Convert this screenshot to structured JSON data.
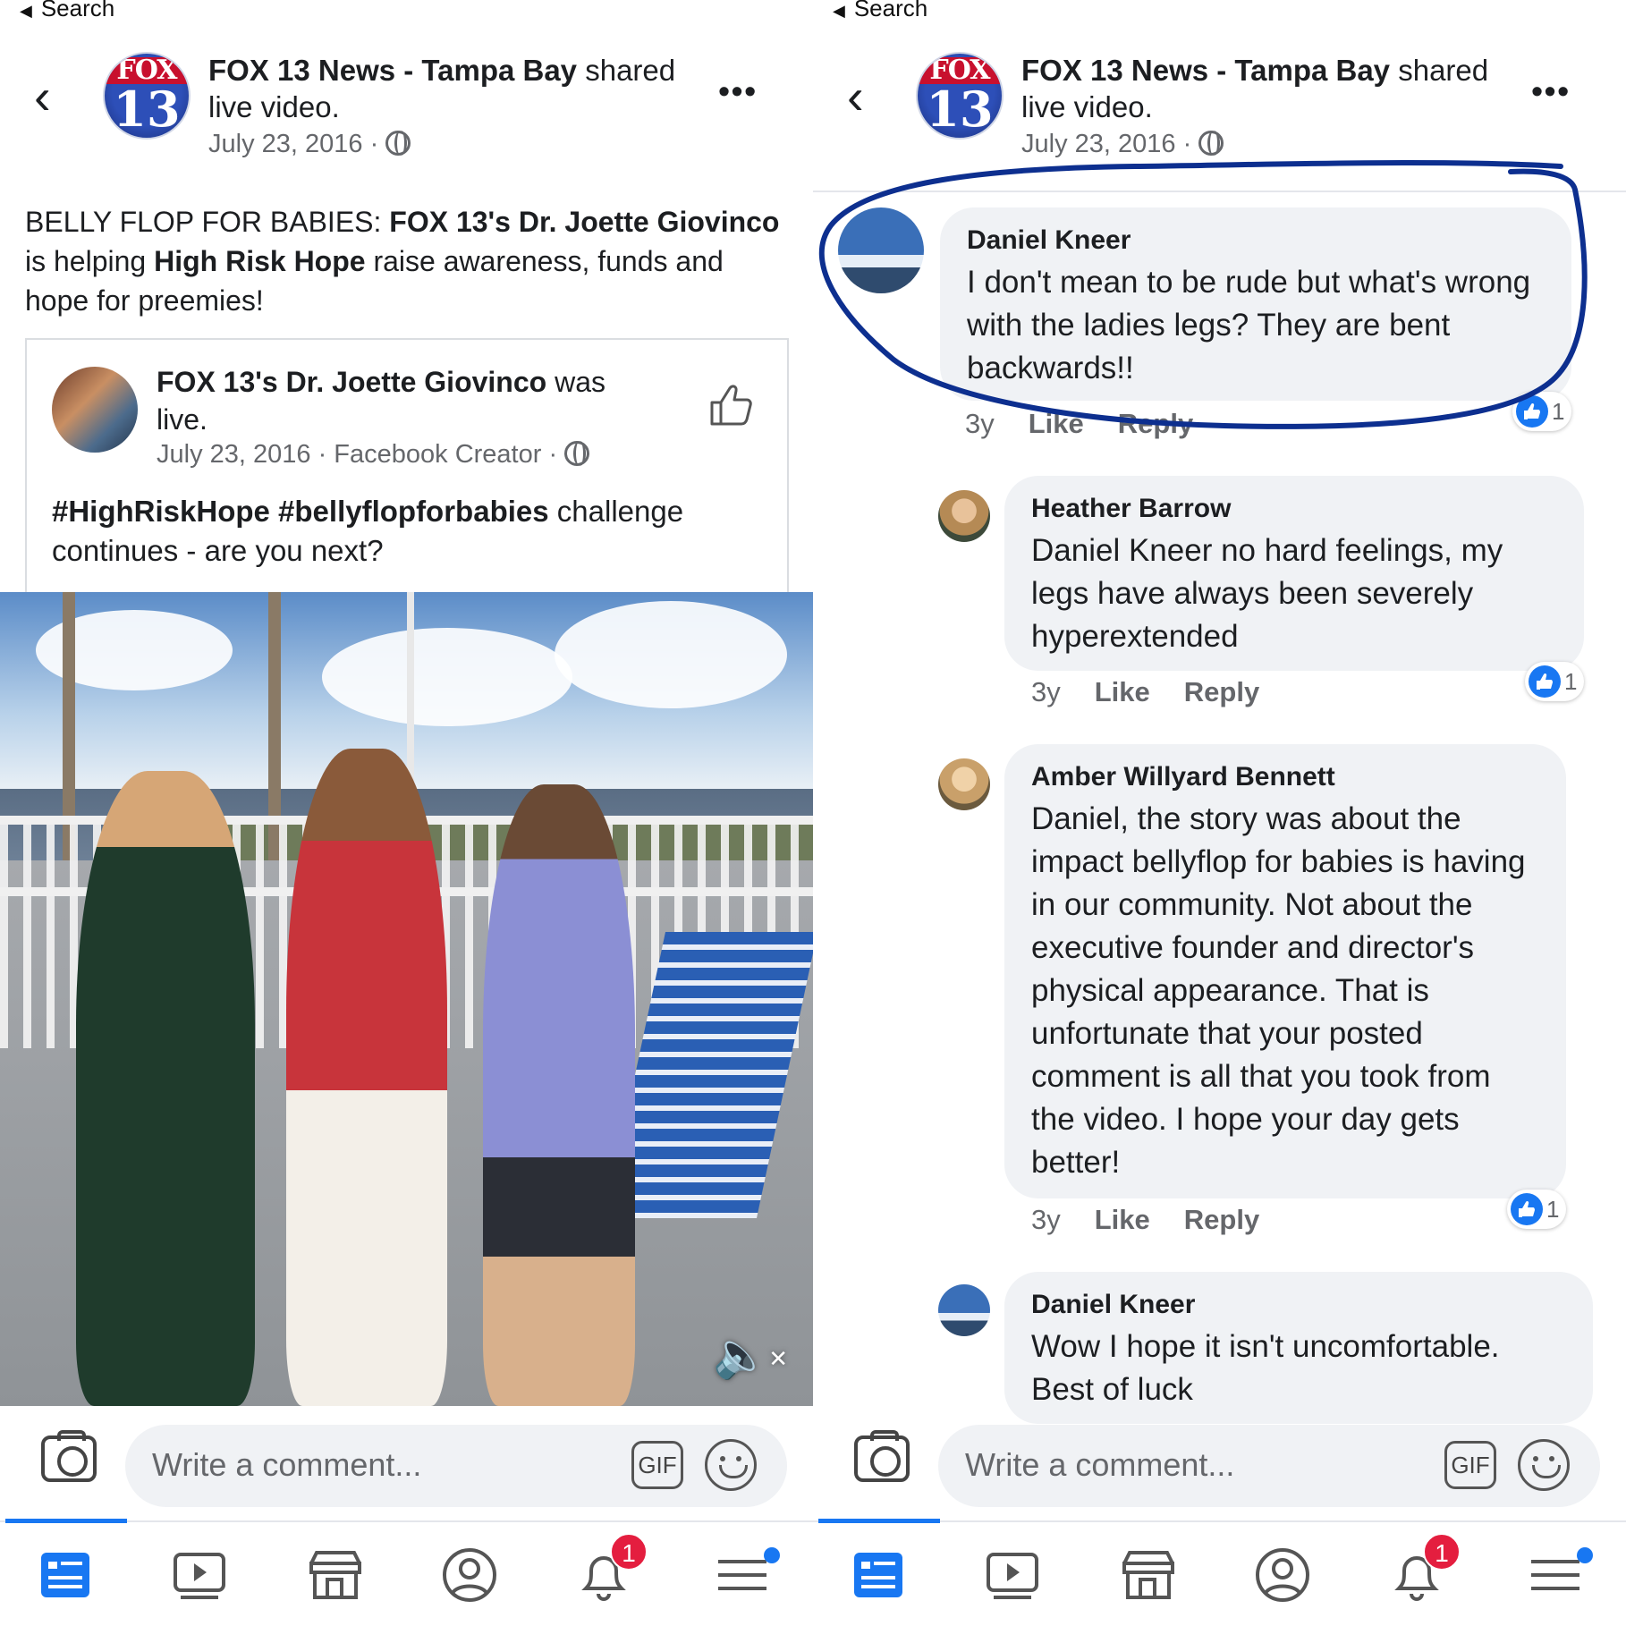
{
  "status_bar": {
    "back_label": "Search"
  },
  "header": {
    "page_name": "FOX 13 News - Tampa Bay",
    "shared_text": " shared live video.",
    "date": "July 23, 2016 · ",
    "logo_top": "FOX",
    "logo_num": "13"
  },
  "post": {
    "text_lead": "BELLY FLOP FOR BABIES: ",
    "text_name": "FOX 13's Dr. Joette Giovinco",
    "text_mid": " is helping ",
    "text_org": "High Risk Hope",
    "text_end": " raise awareness, funds and hope for preemies!"
  },
  "shared_post": {
    "author": "FOX 13's Dr. Joette Giovinco",
    "suffix": " was live.",
    "meta": "July 23, 2016 · Facebook Creator · ",
    "hashtags": "#HighRiskHope #bellyflopforbabies",
    "hashtags_rest": " challenge continues - are you next?"
  },
  "comments": [
    {
      "name": "Daniel Kneer",
      "text": "I don't mean to be rude but what's wrong with the ladies legs?  They are bent backwards!!",
      "age": "3y",
      "like": "Like",
      "reply": "Reply",
      "reactions": "1"
    },
    {
      "name": "Heather Barrow",
      "text": "Daniel Kneer no hard feelings, my legs have always been severely hyperextended",
      "age": "3y",
      "like": "Like",
      "reply": "Reply",
      "reactions": "1"
    },
    {
      "name": "Amber Willyard Bennett",
      "text": "Daniel, the story was about the impact bellyflop for babies is having in our community. Not about the executive founder and director's physical appearance. That is unfortunate that your posted comment is all that you took from the video. I hope your day gets better!",
      "age": "3y",
      "like": "Like",
      "reply": "Reply",
      "reactions": "1"
    },
    {
      "name": "Daniel Kneer",
      "text": "Wow I hope it isn't uncomfortable. Best of luck"
    }
  ],
  "composer": {
    "placeholder": "Write a comment...",
    "gif": "GIF"
  },
  "tabbar": {
    "items": [
      "news-feed",
      "watch",
      "marketplace",
      "profile",
      "notifications",
      "menu"
    ],
    "notification_count": "1"
  },
  "colors": {
    "accent": "#1877f2",
    "highlight_circle": "#0d2f8f",
    "badge": "#e41e3f"
  },
  "icons": [
    "back-chevron-icon",
    "globe-icon",
    "more-icon",
    "thumb-up-icon",
    "mute-icon",
    "camera-icon",
    "gif-icon",
    "emoji-icon"
  ]
}
